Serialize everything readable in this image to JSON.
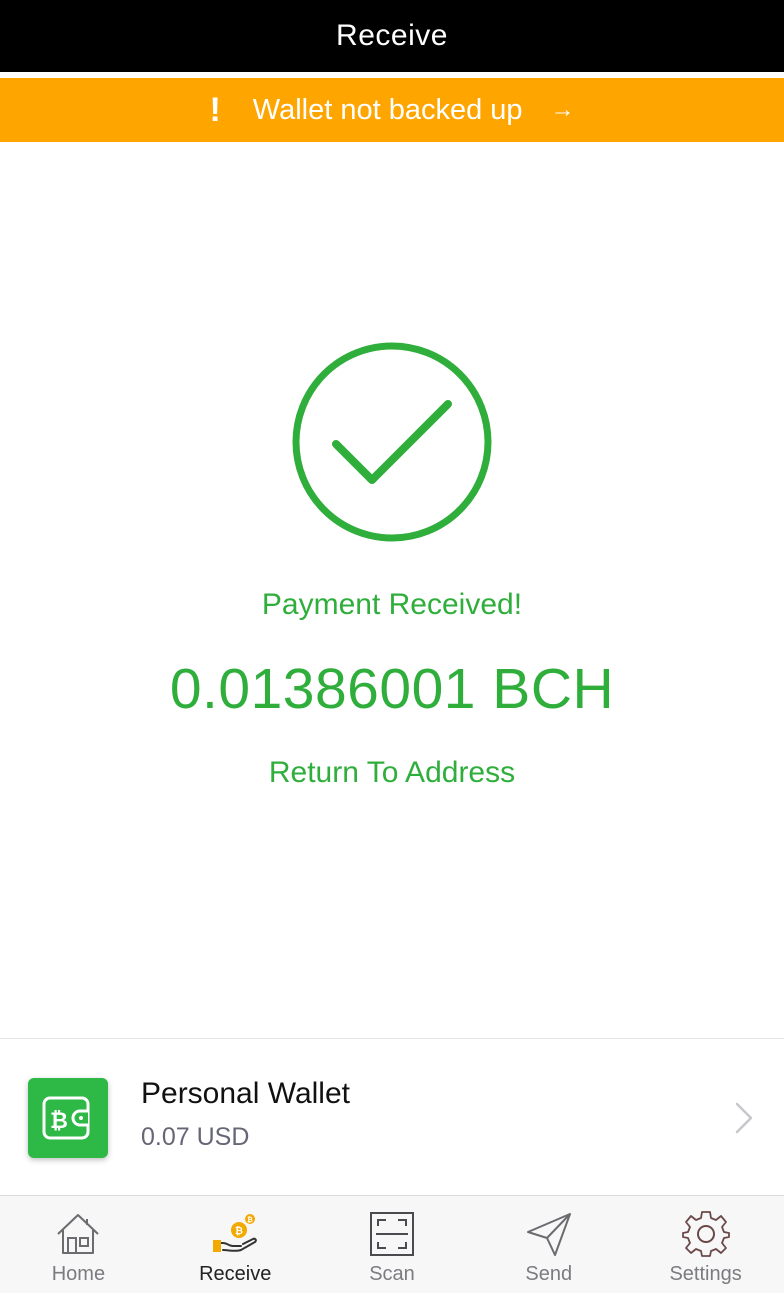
{
  "header": {
    "title": "Receive"
  },
  "banner": {
    "bang": "!",
    "text": "Wallet not backed up",
    "arrow": "→"
  },
  "payment": {
    "status": "Payment Received!",
    "amount": "0.01386001 BCH",
    "return_link": "Return To Address"
  },
  "wallet": {
    "name": "Personal Wallet",
    "balance": "0.07 USD",
    "icon": "wallet-icon"
  },
  "tabs": [
    {
      "label": "Home",
      "icon": "home-icon"
    },
    {
      "label": "Receive",
      "icon": "receive-icon"
    },
    {
      "label": "Scan",
      "icon": "scan-icon"
    },
    {
      "label": "Send",
      "icon": "send-icon"
    },
    {
      "label": "Settings",
      "icon": "gear-icon"
    }
  ],
  "colors": {
    "header_bg": "#000000",
    "banner_bg": "#ffa500",
    "success": "#2fae3c",
    "wallet_icon_bg": "#2eb845",
    "receive_tab_icon": "#f2a900"
  }
}
